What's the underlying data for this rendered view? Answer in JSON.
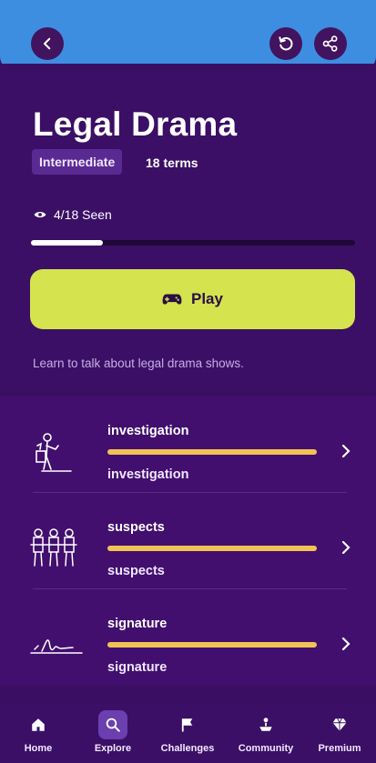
{
  "topbar": {
    "back_icon": "chevron-left-icon",
    "restart_icon": "refresh-icon",
    "share_icon": "share-icon",
    "accent": "#3d8ee0"
  },
  "deck": {
    "title": "Legal Drama",
    "level": "Intermediate",
    "term_count": "18 terms",
    "seen_text": "4/18 Seen",
    "progress_fraction": 0.2222,
    "play_label": "Play",
    "description": "Learn to talk about legal drama shows."
  },
  "terms": [
    {
      "term": "investigation",
      "translation": "investigation",
      "image": "investigation-illustration"
    },
    {
      "term": "suspects",
      "translation": "suspects",
      "image": "suspects-illustration"
    },
    {
      "term": "signature",
      "translation": "signature",
      "image": "signature-illustration"
    }
  ],
  "nav": {
    "items": [
      {
        "label": "Home",
        "icon": "home-icon",
        "active": false
      },
      {
        "label": "Explore",
        "icon": "search-icon",
        "active": true
      },
      {
        "label": "Challenges",
        "icon": "flag-icon",
        "active": false
      },
      {
        "label": "Community",
        "icon": "community-icon",
        "active": false
      },
      {
        "label": "Premium",
        "icon": "diamond-icon",
        "active": false
      }
    ]
  }
}
